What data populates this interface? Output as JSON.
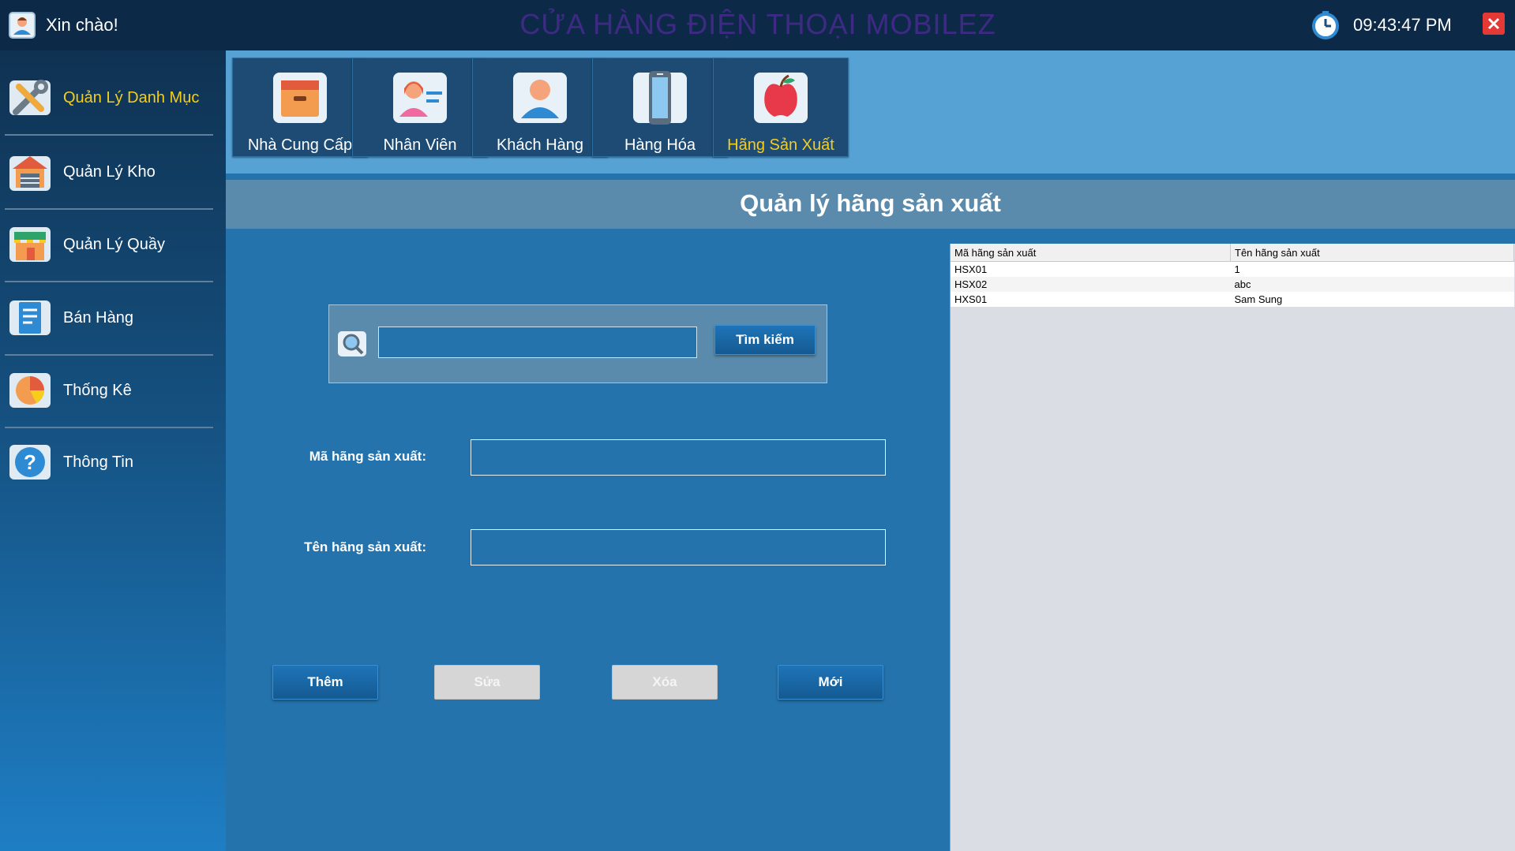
{
  "app": {
    "greeting": "Xin chào!",
    "title": "CỬA HÀNG ĐIỆN THOẠI MOBILEZ",
    "clock": "09:43:47 PM"
  },
  "sidebar": {
    "items": [
      {
        "label": "Quản Lý Danh Mục",
        "icon": "tools-icon",
        "active": true
      },
      {
        "label": "Quản Lý Kho",
        "icon": "warehouse-icon",
        "active": false
      },
      {
        "label": "Quản Lý Quầy",
        "icon": "store-counter-icon",
        "active": false
      },
      {
        "label": "Bán Hàng",
        "icon": "receipt-icon",
        "active": false
      },
      {
        "label": "Thống Kê",
        "icon": "pie-chart-icon",
        "active": false
      },
      {
        "label": "Thông Tin",
        "icon": "question-icon",
        "active": false
      }
    ]
  },
  "categories": [
    {
      "label": "Nhà Cung Cấp",
      "icon": "supplier-box-icon"
    },
    {
      "label": "Nhân Viên",
      "icon": "employee-icon"
    },
    {
      "label": "Khách Hàng",
      "icon": "customer-icon"
    },
    {
      "label": "Hàng Hóa",
      "icon": "phone-icon"
    },
    {
      "label": "Hãng Sản Xuất",
      "icon": "apple-icon",
      "active": true
    }
  ],
  "page": {
    "title": "Quản lý hãng sản xuất"
  },
  "search": {
    "value": "",
    "button": "Tìm kiếm"
  },
  "form": {
    "code_label": "Mã hãng sản xuất:",
    "code_value": "",
    "name_label": "Tên hãng sản xuất:",
    "name_value": ""
  },
  "actions": {
    "add": "Thêm",
    "edit": "Sửa",
    "delete": "Xóa",
    "new": "Mới"
  },
  "table": {
    "headers": [
      "Mã hãng sản xuất",
      "Tên hãng sản xuất"
    ],
    "rows": [
      [
        "HSX01",
        "1"
      ],
      [
        "HSX02",
        "abc"
      ],
      [
        "HXS01",
        "Sam Sung"
      ]
    ]
  },
  "colors": {
    "active_text": "#f7cd1b",
    "title_color": "#3e2a84",
    "close_red": "#e53935"
  }
}
